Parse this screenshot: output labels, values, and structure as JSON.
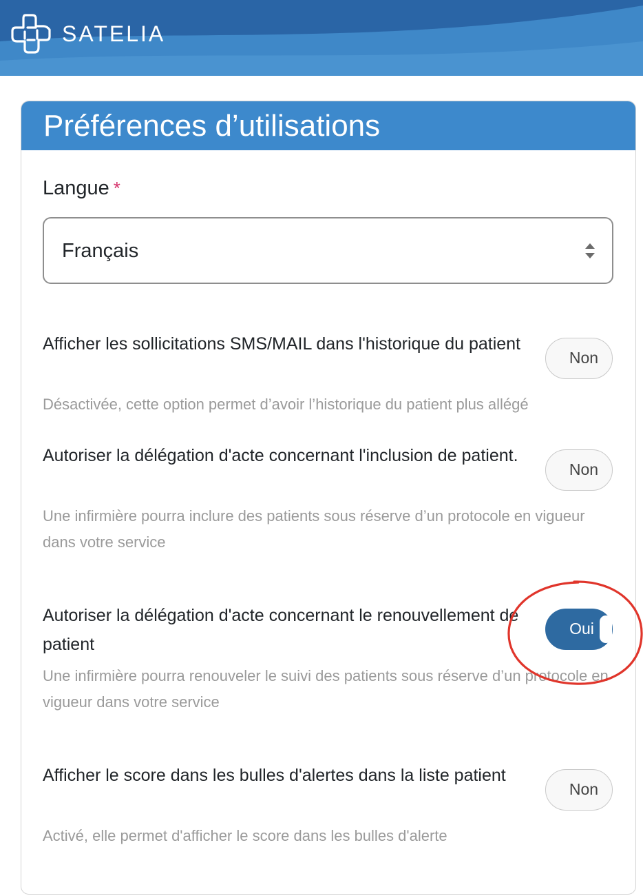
{
  "brand": {
    "name": "SATELIA",
    "header_color": "#2f6fb0"
  },
  "card": {
    "title": "Préférences d’utilisations",
    "header_color": "#3d89cc"
  },
  "language": {
    "label": "Langue",
    "required_marker": "*",
    "selected": "Français"
  },
  "options": [
    {
      "title": "Afficher les sollicitations SMS/MAIL dans l'historique du patient",
      "description": "Désactivée, cette option permet d’avoir l’historique du patient plus allégé",
      "toggle_label": "Non",
      "state": "off"
    },
    {
      "title": "Autoriser la délégation d'acte concernant l'inclusion de patient.",
      "description": "Une infirmière pourra inclure des patients sous réserve d’un protocole en vigueur dans votre service",
      "toggle_label": "Non",
      "state": "off"
    },
    {
      "title": "Autoriser la délégation d'acte concernant le renouvellement de patient",
      "description": "Une infirmière pourra renouveler le suivi des patients sous réserve d’un protocole en vigueur dans votre service",
      "toggle_label": "Oui",
      "state": "on"
    },
    {
      "title": "Afficher le score dans les bulles d'alertes dans la liste patient",
      "description": "Activé, elle permet d'afficher le score dans les bulles d'alerte",
      "toggle_label": "Non",
      "state": "off"
    }
  ],
  "colors": {
    "toggle_on": "#2e6aa1",
    "annotation": "#e0352b",
    "required": "#d6336c"
  },
  "icons": {
    "logo": "satelia-logo-icon",
    "select": "sort-arrows-icon"
  }
}
